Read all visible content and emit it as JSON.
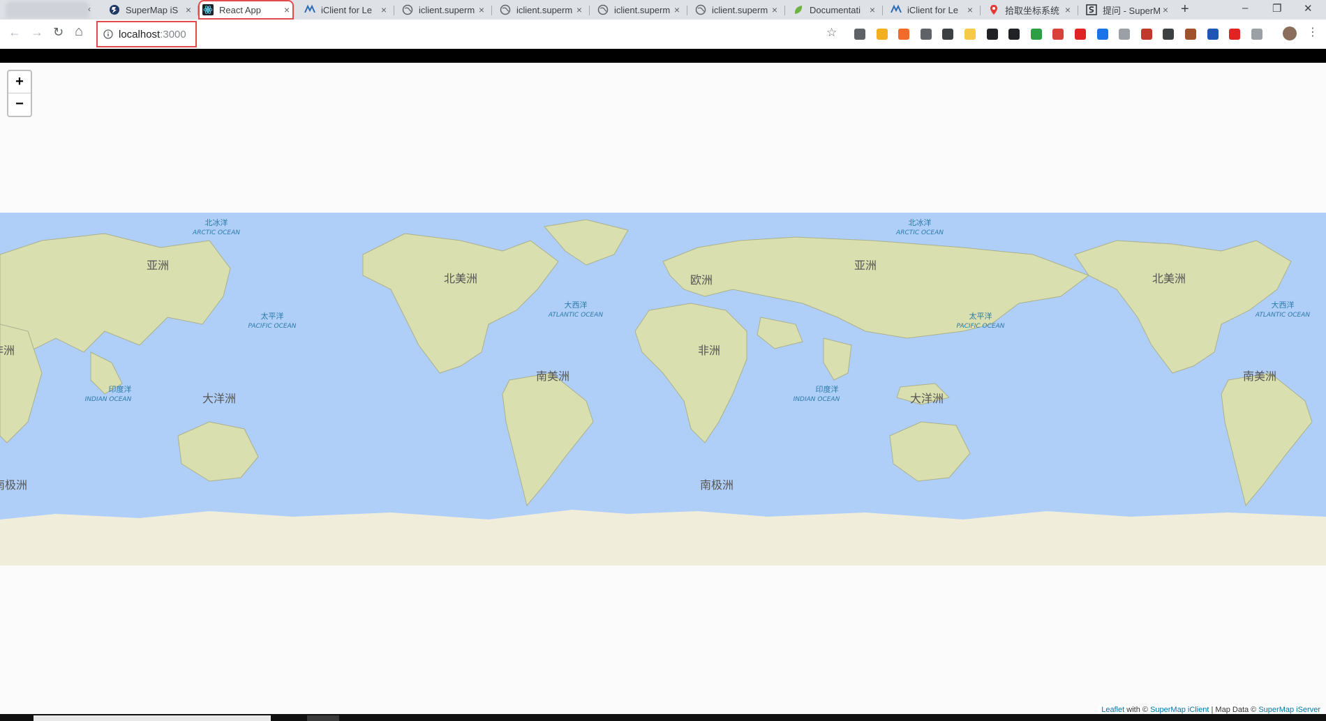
{
  "browser": {
    "tabs": [
      {
        "label": "SuperMap iS",
        "icon": "supermap-icon"
      },
      {
        "label": "React App",
        "icon": "react-icon",
        "active": true
      },
      {
        "label": "iClient for Le",
        "icon": "iclient-icon"
      },
      {
        "label": "iclient.superm",
        "icon": "globe-icon"
      },
      {
        "label": "iclient.superm",
        "icon": "globe-icon"
      },
      {
        "label": "iclient.superm",
        "icon": "globe-icon"
      },
      {
        "label": "iclient.superm",
        "icon": "globe-icon"
      },
      {
        "label": "Documentati",
        "icon": "leaf-icon"
      },
      {
        "label": "iClient for Le",
        "icon": "iclient-icon"
      },
      {
        "label": "拾取坐标系统",
        "icon": "map-pin-icon"
      },
      {
        "label": "提问 - SuperM",
        "icon": "s-logo-icon"
      }
    ],
    "close_glyph": "×",
    "new_tab_glyph": "+",
    "scroll_left_glyph": "‹",
    "window_controls": {
      "minimize": "–",
      "restore": "❐",
      "close": "✕"
    },
    "nav": {
      "back": "←",
      "forward": "→",
      "reload": "↻",
      "home": "⌂"
    },
    "address": {
      "host": "localhost",
      "port": ":3000"
    },
    "bookmark_glyph": "☆",
    "menu_glyph": "⋮",
    "extension_colors": [
      "#5f6368",
      "#f2b01e",
      "#f26b2a",
      "#5f6368",
      "#3c4043",
      "#f7c948",
      "#202124",
      "#202124",
      "#2e9e44",
      "#d9423a",
      "#e02424",
      "#1a73e8",
      "#9aa0a6",
      "#c0392b",
      "#3c4043",
      "#a0522d",
      "#1e56b5",
      "#e02424",
      "#9aa0a6"
    ]
  },
  "map": {
    "zoom_in": "+",
    "zoom_out": "−",
    "ocean_color": "#b0cff8",
    "land_color": "#d9dfae",
    "ice_color": "#f1eddb",
    "labels": [
      {
        "text": "北冰洋",
        "sub": "ARCTIC OCEAN",
        "kind": "ocean"
      },
      {
        "text": "亚洲",
        "kind": "continent"
      },
      {
        "text": "太平洋",
        "sub": "PACIFIC OCEAN",
        "kind": "ocean"
      },
      {
        "text": "印度洋",
        "sub": "INDIAN OCEAN",
        "kind": "ocean"
      },
      {
        "text": "大洋洲",
        "kind": "continent"
      },
      {
        "text": "北美洲",
        "kind": "continent"
      },
      {
        "text": "大西洋",
        "sub": "ATLANTIC OCEAN",
        "kind": "ocean"
      },
      {
        "text": "南美洲",
        "kind": "continent"
      },
      {
        "text": "欧洲",
        "kind": "continent"
      },
      {
        "text": "非洲",
        "kind": "continent"
      },
      {
        "text": "南极洲",
        "kind": "continent"
      }
    ],
    "attribution": {
      "leaflet": "Leaflet",
      "with": " with © ",
      "iclient": "SuperMap iClient",
      "mapdata": " | Map Data © ",
      "iserver": "SuperMap iServer"
    }
  }
}
